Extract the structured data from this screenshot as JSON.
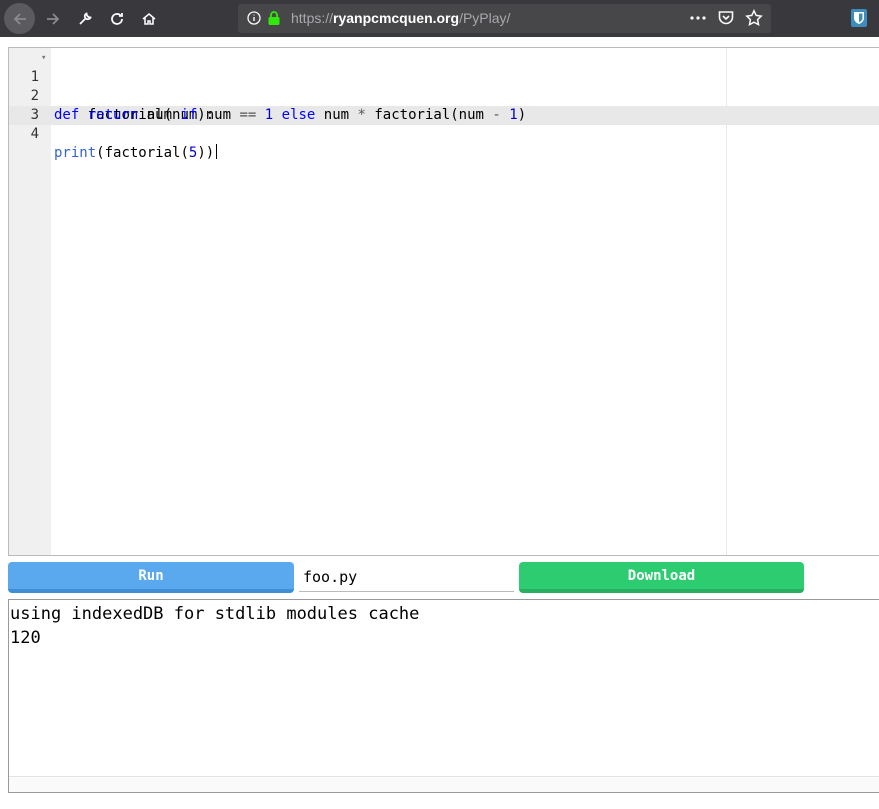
{
  "browser": {
    "url": {
      "scheme": "https://",
      "host": "ryanpcmcquen.org",
      "path": "/PyPlay/"
    }
  },
  "editor": {
    "lines": [
      {
        "number": "1",
        "has_fold": true
      },
      {
        "number": "2",
        "has_fold": false
      },
      {
        "number": "3",
        "has_fold": false
      },
      {
        "number": "4",
        "has_fold": false
      }
    ],
    "code": {
      "l1_def": "def",
      "l1_rest": " factorial(num):",
      "l2_indent": "    ",
      "l2_return": "return",
      "l2_a": " num ",
      "l2_if": "if",
      "l2_b": " num ",
      "l2_eq": "==",
      "l2_sp1": " ",
      "l2_one": "1",
      "l2_sp2": " ",
      "l2_else": "else",
      "l2_c": " num ",
      "l2_mul": "*",
      "l2_d": " factorial(num ",
      "l2_minus": "-",
      "l2_sp3": " ",
      "l2_one2": "1",
      "l2_close": ")",
      "l4_print": "print",
      "l4_a": "(factorial(",
      "l4_five": "5",
      "l4_b": "))"
    }
  },
  "controls": {
    "run_label": "Run",
    "filename_value": "foo.py",
    "download_label": "Download"
  },
  "output": {
    "lines": [
      "using indexedDB for stdlib modules cache",
      "120"
    ]
  },
  "colors": {
    "run_button": "#5aa9ee",
    "download_button": "#2ecc71",
    "keyword": "#0000ff",
    "toolbar": "#38383d"
  }
}
